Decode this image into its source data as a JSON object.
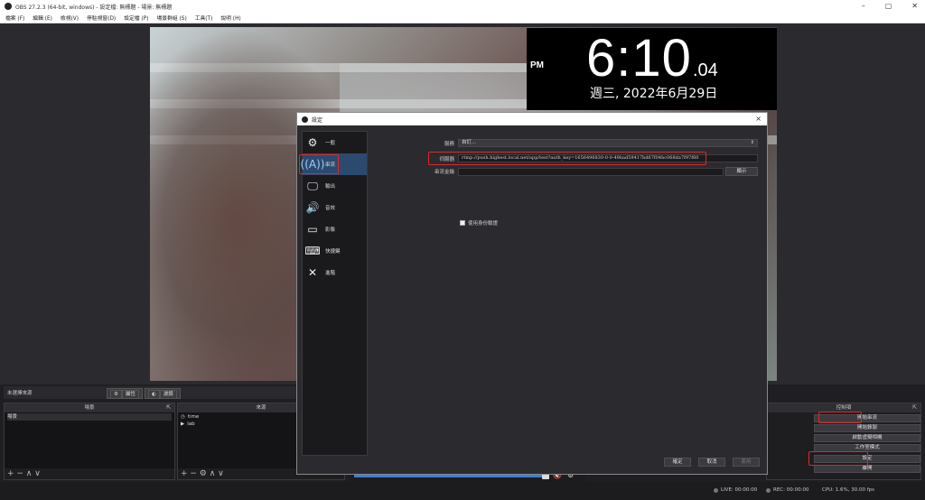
{
  "window": {
    "title": "OBS 27.2.3 (64-bit, windows) - 設定檔: 無標題 - 場景: 無標題",
    "controls": [
      "–",
      "▢",
      "✕"
    ]
  },
  "menu": [
    "檔案 (F)",
    "編輯 (E)",
    "檢視(V)",
    "停駐視窗(D)",
    "設定檔 (P)",
    "場景群組 (S)",
    "工具(T)",
    "說明 (H)"
  ],
  "clock": {
    "ampm": "PM",
    "time": "6:10",
    "seconds": ".04",
    "date": "週三, 2022年6月29日"
  },
  "scene_bar": {
    "no_source": "未選擇來源",
    "properties": "屬性",
    "filters": "濾鏡"
  },
  "scenes_dock": {
    "title": "場景",
    "items": [
      "場景"
    ],
    "footer": "+ − ∧ ∨"
  },
  "sources_dock": {
    "title": "來源",
    "items": [
      {
        "icon": "clock-icon",
        "label": "time"
      },
      {
        "icon": "play-icon",
        "label": "lab"
      }
    ],
    "footer": "+ − ⚙ ∧ ∨"
  },
  "controls_dock": {
    "title": "控制項",
    "buttons": [
      "開始串流",
      "開始錄製",
      "啟動虛擬相機",
      "工作室模式",
      "設定",
      "離開"
    ]
  },
  "status": {
    "live": "LIVE: 00:00:00",
    "rec": "REC: 00:00:00",
    "cpu": "CPU: 1.6%, 30.00 fps"
  },
  "dialog": {
    "title": "設定",
    "close": "×",
    "sidebar": [
      {
        "icon": "gear-icon",
        "label": "一般"
      },
      {
        "icon": "antenna-icon",
        "label": "串流"
      },
      {
        "icon": "monitor-output-icon",
        "label": "輸出"
      },
      {
        "icon": "speaker-icon",
        "label": "音效"
      },
      {
        "icon": "display-icon",
        "label": "影像"
      },
      {
        "icon": "keyboard-icon",
        "label": "快捷鍵"
      },
      {
        "icon": "tools-icon",
        "label": "進階"
      }
    ],
    "form": {
      "service_label": "服務",
      "service_value": "自訂...",
      "server_label": "伺服器",
      "server_value": "rtmp://push.highest.local.net/app/test?auth_key=1656496830-0-0-49bad59417bd67f04bc068da7f97f60",
      "key_label": "串流金鑰",
      "key_value": "",
      "show_label": "顯示",
      "auth_label": "使用身份驗證"
    },
    "footer": {
      "ok": "確定",
      "cancel": "取消",
      "apply": "套用"
    }
  },
  "colors": {
    "highlight": "#e0262b",
    "accent": "#2c4a6e"
  }
}
